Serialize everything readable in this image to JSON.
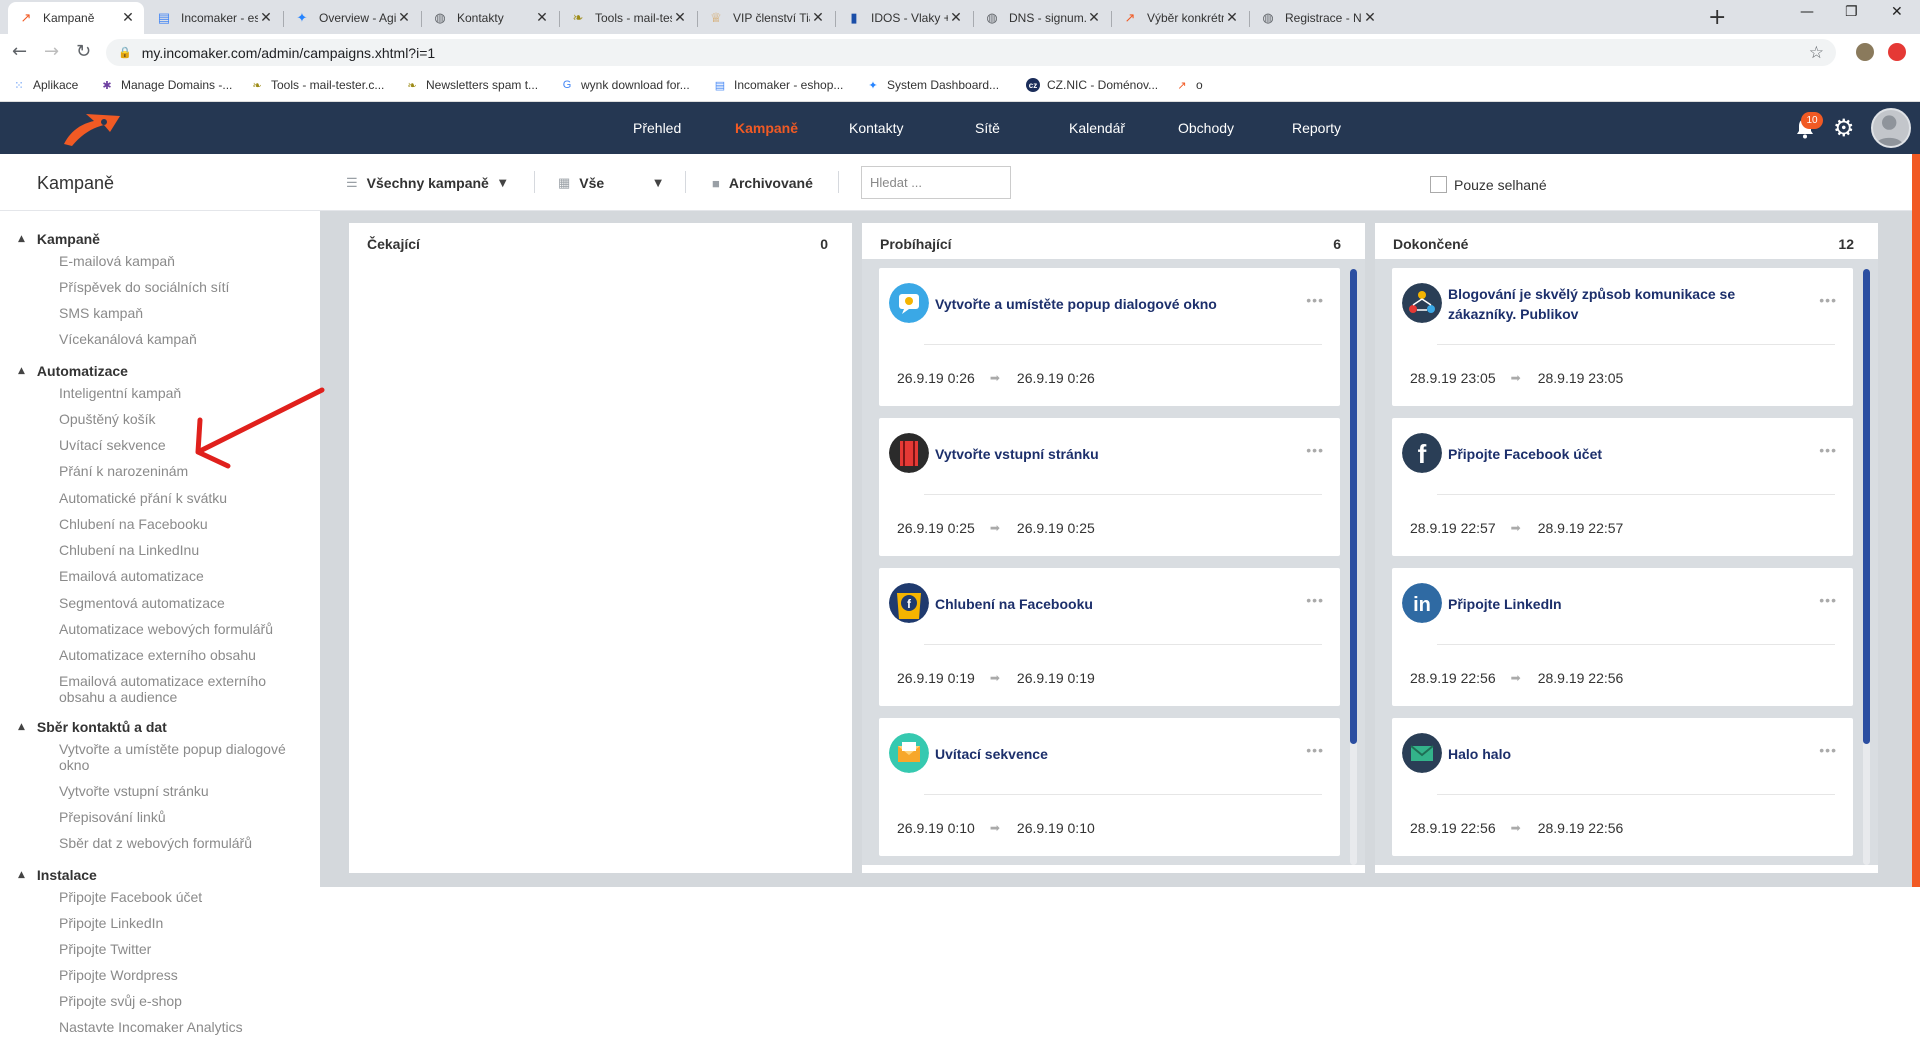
{
  "browser": {
    "tabs": [
      {
        "title": "Kampaně",
        "favicon_color": "#f15a24",
        "favicon_glyph": "↗",
        "active": true
      },
      {
        "title": "Incomaker - eshop",
        "favicon_color": "#4285f4",
        "favicon_glyph": "▤",
        "active": false
      },
      {
        "title": "Overview - Agile Bo",
        "favicon_color": "#2684ff",
        "favicon_glyph": "✦",
        "active": false
      },
      {
        "title": "Kontakty",
        "favicon_color": "#5f6368",
        "favicon_glyph": "◍",
        "active": false
      },
      {
        "title": "Tools - mail-tester.c",
        "favicon_color": "#9c8a14",
        "favicon_glyph": "❧",
        "active": false
      },
      {
        "title": "VIP členství Tiande",
        "favicon_color": "#d4a25a",
        "favicon_glyph": "♕",
        "active": false
      },
      {
        "title": "IDOS - Vlaky + Auto",
        "favicon_color": "#1a4ea8",
        "favicon_glyph": "▮",
        "active": false
      },
      {
        "title": "DNS - signum.cz",
        "favicon_color": "#5f6368",
        "favicon_glyph": "◍",
        "active": false
      },
      {
        "title": "Výběr konkrétních",
        "favicon_color": "#f15a24",
        "favicon_glyph": "↗",
        "active": false
      },
      {
        "title": "Registrace - Náklad",
        "favicon_color": "#5f6368",
        "favicon_glyph": "◍",
        "active": false
      }
    ],
    "url": "my.incomaker.com/admin/campaigns.xhtml?i=1",
    "bookmarks": [
      {
        "label": "Aplikace",
        "icon": "apps-grid-icon",
        "color": "#4285f4",
        "glyph": "⁙"
      },
      {
        "label": "Manage Domains -...",
        "icon": "domains-icon",
        "color": "#6d3fa0",
        "glyph": "✱"
      },
      {
        "label": "Tools - mail-tester.c...",
        "icon": "leaf-icon",
        "color": "#9c8a14",
        "glyph": "❧"
      },
      {
        "label": "Newsletters spam t...",
        "icon": "leaf-icon",
        "color": "#9c8a14",
        "glyph": "❧"
      },
      {
        "label": "wynk download for...",
        "icon": "google-icon",
        "color": "#4285f4",
        "glyph": "G"
      },
      {
        "label": "Incomaker - eshop...",
        "icon": "doc-icon",
        "color": "#4285f4",
        "glyph": "▤"
      },
      {
        "label": "System Dashboard...",
        "icon": "jira-icon",
        "color": "#2684ff",
        "glyph": "✦"
      },
      {
        "label": "CZ.NIC - Doménov...",
        "icon": "cznic-icon",
        "color": "#1b2d5a",
        "glyph": "cz"
      },
      {
        "label": "o",
        "icon": "incomaker-icon",
        "color": "#f15a24",
        "glyph": "↗"
      }
    ]
  },
  "app": {
    "nav": [
      "Přehled",
      "Kampaně",
      "Kontakty",
      "Sítě",
      "Kalendář",
      "Obchody",
      "Reporty"
    ],
    "active_nav": "Kampaně",
    "notifications": "10",
    "accent_color": "#f15a24",
    "header_color": "#253752"
  },
  "toolbar": {
    "title": "Kampaně",
    "filter_campaigns": "Všechny kampaně",
    "filter_all": "Vše",
    "archived": "Archivované",
    "search_placeholder": "Hledat ...",
    "only_failed": "Pouze selhané"
  },
  "sidebar": {
    "sections": [
      {
        "title": "Kampaně",
        "items": [
          "E-mailová kampaň",
          "Příspěvek do sociálních sítí",
          "SMS kampaň",
          "Vícekanálová kampaň"
        ]
      },
      {
        "title": "Automatizace",
        "items": [
          "Inteligentní kampaň",
          "Opuštěný košík",
          "Uvítací sekvence",
          "Přání k narozeninám",
          "Automatické přání k svátku",
          "Chlubení na Facebooku",
          "Chlubení na LinkedInu",
          "Emailová automatizace",
          "Segmentová automatizace",
          "Automatizace webových formulářů",
          "Automatizace externího obsahu",
          "Emailová automatizace externího obsahu a audience"
        ]
      },
      {
        "title": "Sběr kontaktů a dat",
        "items": [
          "Vytvořte a umístěte popup dialogové okno",
          "Vytvořte vstupní stránku",
          "Přepisování linků",
          "Sběr dat z webových formulářů"
        ]
      },
      {
        "title": "Instalace",
        "items": [
          "Připojte Facebook účet",
          "Připojte LinkedIn",
          "Připojte Twitter",
          "Připojte Wordpress",
          "Připojte svůj e-shop",
          "Nastavte Incomaker Analytics"
        ]
      }
    ]
  },
  "columns": [
    {
      "name": "Čekající",
      "count": "0",
      "cards": []
    },
    {
      "name": "Probíhající",
      "count": "6",
      "cards": [
        {
          "title": "Vytvořte a umístěte popup dialogové okno",
          "start": "26.9.19 0:26",
          "end": "26.9.19 0:26",
          "icon": "popup-icon"
        },
        {
          "title": "Vytvořte vstupní stránku",
          "start": "26.9.19 0:25",
          "end": "26.9.19 0:25",
          "icon": "landing-page-icon"
        },
        {
          "title": "Chlubení na Facebooku",
          "start": "26.9.19 0:19",
          "end": "26.9.19 0:19",
          "icon": "facebook-badge-icon"
        },
        {
          "title": "Uvítací sekvence",
          "start": "26.9.19 0:10",
          "end": "26.9.19 0:10",
          "icon": "welcome-mail-icon"
        }
      ]
    },
    {
      "name": "Dokončené",
      "count": "12",
      "cards": [
        {
          "title": "Blogování je skvělý způsob komunikace se zákazníky. Publikov",
          "start": "28.9.19 23:05",
          "end": "28.9.19 23:05",
          "icon": "blog-network-icon"
        },
        {
          "title": "Připojte Facebook účet",
          "start": "28.9.19 22:57",
          "end": "28.9.19 22:57",
          "icon": "facebook-icon"
        },
        {
          "title": "Připojte LinkedIn",
          "start": "28.9.19 22:56",
          "end": "28.9.19 22:56",
          "icon": "linkedin-icon"
        },
        {
          "title": "Halo halo",
          "start": "28.9.19 22:56",
          "end": "28.9.19 22:56",
          "icon": "email-icon"
        }
      ]
    }
  ]
}
